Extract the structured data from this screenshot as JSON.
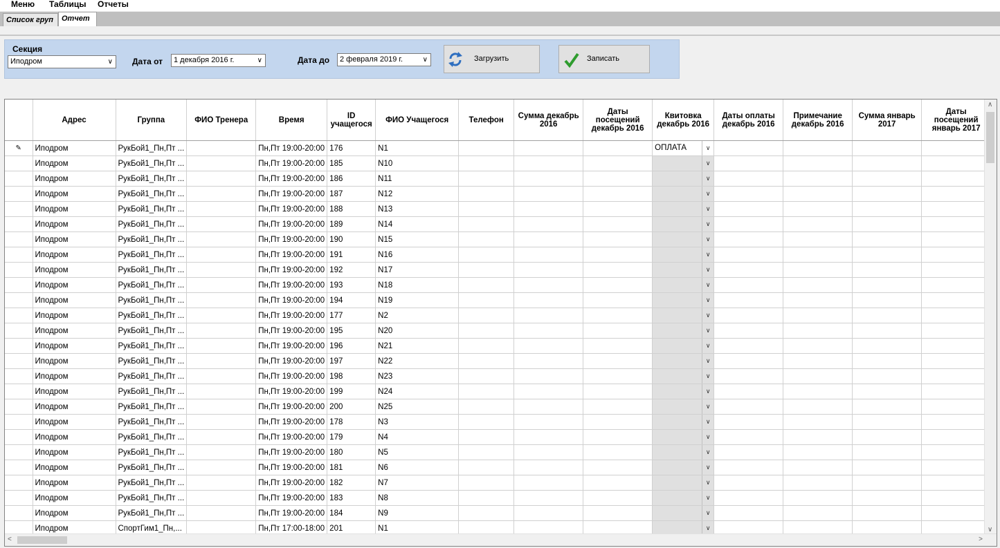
{
  "menu": [
    "Меню",
    "Таблицы",
    "Отчеты"
  ],
  "tabs": [
    {
      "label": "Список груп",
      "active": false
    },
    {
      "label": "Отчет",
      "active": true
    }
  ],
  "filters": {
    "section_label": "Секция",
    "section_value": "Иподром",
    "date_from_label": "Дата от",
    "date_from_value": "1 декабря  2016 г.",
    "date_to_label": "Дата до",
    "date_to_value": "2 февраля  2019 г.",
    "load_button": "Загрузить",
    "save_button": "Записать"
  },
  "colors": {
    "panel": "#c3d6ee",
    "check": "#2e9c2e",
    "refresh": "#2f6fc0"
  },
  "icons": {
    "load": "refresh-icon",
    "save": "checkmark-icon"
  },
  "columns": [
    "Адрес",
    "Группа",
    "ФИО Тренера",
    "Время",
    "ID учащегося",
    "ФИО Учащегося",
    "Телефон",
    "Сумма декабрь 2016",
    "Даты посещений декабрь 2016",
    "Квитовка декабрь 2016",
    "Даты оплаты декабрь 2016",
    "Примечание декабрь 2016",
    "Сумма январь 2017",
    "Даты посещений январь 2017"
  ],
  "rows": [
    {
      "addr": "Иподром",
      "group": "РукБой1_Пн,Пт ...",
      "trainer": "",
      "time": "Пн,Пт 19:00-20:00",
      "id": "176",
      "name": "N1",
      "kvit": "ОПЛАТА",
      "edit": true
    },
    {
      "addr": "Иподром",
      "group": "РукБой1_Пн,Пт ...",
      "trainer": "",
      "time": "Пн,Пт 19:00-20:00",
      "id": "185",
      "name": "N10",
      "kvit": ""
    },
    {
      "addr": "Иподром",
      "group": "РукБой1_Пн,Пт ...",
      "trainer": "",
      "time": "Пн,Пт 19:00-20:00",
      "id": "186",
      "name": "N11",
      "kvit": ""
    },
    {
      "addr": "Иподром",
      "group": "РукБой1_Пн,Пт ...",
      "trainer": "",
      "time": "Пн,Пт 19:00-20:00",
      "id": "187",
      "name": "N12",
      "kvit": ""
    },
    {
      "addr": "Иподром",
      "group": "РукБой1_Пн,Пт ...",
      "trainer": "",
      "time": "Пн,Пт 19:00-20:00",
      "id": "188",
      "name": "N13",
      "kvit": ""
    },
    {
      "addr": "Иподром",
      "group": "РукБой1_Пн,Пт ...",
      "trainer": "",
      "time": "Пн,Пт 19:00-20:00",
      "id": "189",
      "name": "N14",
      "kvit": ""
    },
    {
      "addr": "Иподром",
      "group": "РукБой1_Пн,Пт ...",
      "trainer": "",
      "time": "Пн,Пт 19:00-20:00",
      "id": "190",
      "name": "N15",
      "kvit": ""
    },
    {
      "addr": "Иподром",
      "group": "РукБой1_Пн,Пт ...",
      "trainer": "",
      "time": "Пн,Пт 19:00-20:00",
      "id": "191",
      "name": "N16",
      "kvit": ""
    },
    {
      "addr": "Иподром",
      "group": "РукБой1_Пн,Пт ...",
      "trainer": "",
      "time": "Пн,Пт 19:00-20:00",
      "id": "192",
      "name": "N17",
      "kvit": ""
    },
    {
      "addr": "Иподром",
      "group": "РукБой1_Пн,Пт ...",
      "trainer": "",
      "time": "Пн,Пт 19:00-20:00",
      "id": "193",
      "name": "N18",
      "kvit": ""
    },
    {
      "addr": "Иподром",
      "group": "РукБой1_Пн,Пт ...",
      "trainer": "",
      "time": "Пн,Пт 19:00-20:00",
      "id": "194",
      "name": "N19",
      "kvit": ""
    },
    {
      "addr": "Иподром",
      "group": "РукБой1_Пн,Пт ...",
      "trainer": "",
      "time": "Пн,Пт 19:00-20:00",
      "id": "177",
      "name": "N2",
      "kvit": ""
    },
    {
      "addr": "Иподром",
      "group": "РукБой1_Пн,Пт ...",
      "trainer": "",
      "time": "Пн,Пт 19:00-20:00",
      "id": "195",
      "name": "N20",
      "kvit": ""
    },
    {
      "addr": "Иподром",
      "group": "РукБой1_Пн,Пт ...",
      "trainer": "",
      "time": "Пн,Пт 19:00-20:00",
      "id": "196",
      "name": "N21",
      "kvit": ""
    },
    {
      "addr": "Иподром",
      "group": "РукБой1_Пн,Пт ...",
      "trainer": "",
      "time": "Пн,Пт 19:00-20:00",
      "id": "197",
      "name": "N22",
      "kvit": ""
    },
    {
      "addr": "Иподром",
      "group": "РукБой1_Пн,Пт ...",
      "trainer": "",
      "time": "Пн,Пт 19:00-20:00",
      "id": "198",
      "name": "N23",
      "kvit": ""
    },
    {
      "addr": "Иподром",
      "group": "РукБой1_Пн,Пт ...",
      "trainer": "",
      "time": "Пн,Пт 19:00-20:00",
      "id": "199",
      "name": "N24",
      "kvit": ""
    },
    {
      "addr": "Иподром",
      "group": "РукБой1_Пн,Пт ...",
      "trainer": "",
      "time": "Пн,Пт 19:00-20:00",
      "id": "200",
      "name": "N25",
      "kvit": ""
    },
    {
      "addr": "Иподром",
      "group": "РукБой1_Пн,Пт ...",
      "trainer": "",
      "time": "Пн,Пт 19:00-20:00",
      "id": "178",
      "name": "N3",
      "kvit": ""
    },
    {
      "addr": "Иподром",
      "group": "РукБой1_Пн,Пт ...",
      "trainer": "",
      "time": "Пн,Пт 19:00-20:00",
      "id": "179",
      "name": "N4",
      "kvit": ""
    },
    {
      "addr": "Иподром",
      "group": "РукБой1_Пн,Пт ...",
      "trainer": "",
      "time": "Пн,Пт 19:00-20:00",
      "id": "180",
      "name": "N5",
      "kvit": ""
    },
    {
      "addr": "Иподром",
      "group": "РукБой1_Пн,Пт ...",
      "trainer": "",
      "time": "Пн,Пт 19:00-20:00",
      "id": "181",
      "name": "N6",
      "kvit": ""
    },
    {
      "addr": "Иподром",
      "group": "РукБой1_Пн,Пт ...",
      "trainer": "",
      "time": "Пн,Пт 19:00-20:00",
      "id": "182",
      "name": "N7",
      "kvit": ""
    },
    {
      "addr": "Иподром",
      "group": "РукБой1_Пн,Пт ...",
      "trainer": "",
      "time": "Пн,Пт 19:00-20:00",
      "id": "183",
      "name": "N8",
      "kvit": ""
    },
    {
      "addr": "Иподром",
      "group": "РукБой1_Пн,Пт ...",
      "trainer": "",
      "time": "Пн,Пт 19:00-20:00",
      "id": "184",
      "name": "N9",
      "kvit": ""
    },
    {
      "addr": "Иподром",
      "group": "СпортГим1_Пн,...",
      "trainer": "",
      "time": "Пн,Пт 17:00-18:00",
      "id": "201",
      "name": "N1",
      "kvit": ""
    }
  ]
}
